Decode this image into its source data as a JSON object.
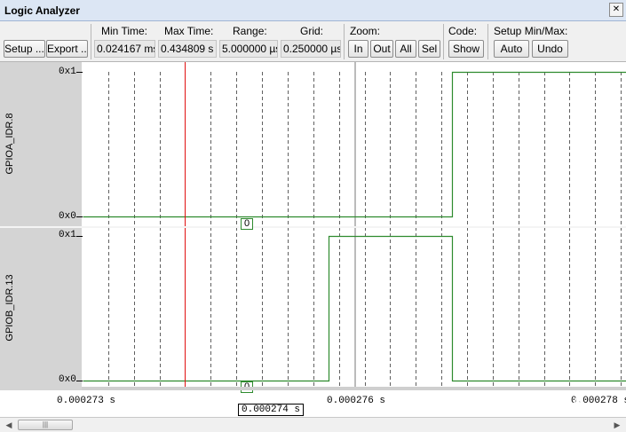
{
  "window": {
    "title": "Logic Analyzer",
    "close_glyph": "✕"
  },
  "toolbar": {
    "setup_label": "Setup ...",
    "export_label": "Export ...",
    "min_time_label": "Min Time:",
    "min_time_value": "0.024167 ms",
    "max_time_label": "Max Time:",
    "max_time_value": "0.434809 s",
    "range_label": "Range:",
    "range_value": "5.000000 µs",
    "grid_label": "Grid:",
    "grid_value": "0.250000 µs",
    "zoom_label": "Zoom:",
    "zoom_in": "In",
    "zoom_out": "Out",
    "zoom_all": "All",
    "zoom_sel": "Sel",
    "code_label": "Code:",
    "code_show": "Show",
    "setup_minmax_label": "Setup Min/Max:",
    "auto_label": "Auto",
    "undo_label": "Undo"
  },
  "signals": [
    {
      "name": "GPIOA_IDR.8",
      "max_label": "0x1",
      "min_label": "0x0",
      "cursor_value": "0"
    },
    {
      "name": "GPIOB_IDR.13",
      "max_label": "0x1",
      "min_label": "0x0",
      "cursor_value": "0"
    }
  ],
  "time_axis": {
    "labels": [
      "0.000273  s",
      "0.000276  s",
      "0.000278  s"
    ],
    "cursor_label": "0.000274  s"
  },
  "scrollbar": {
    "left_arrow": "◀",
    "right_arrow": "▶",
    "thumb_grip": "|||"
  },
  "watermark": {
    "text": "电子发烧友",
    "url": "www.elecfans.com"
  },
  "colors": {
    "trace": "#2e8b2e",
    "cursor": "#e01010",
    "grid": "#606060",
    "name_panel": "#d4d4d4",
    "titlebar": "#dce6f4"
  },
  "chart_data": {
    "type": "line",
    "x_unit": "s",
    "series": [
      {
        "name": "GPIOA_IDR.8",
        "points": [
          [
            0.000273,
            0
          ],
          [
            0.0002766,
            0
          ],
          [
            0.0002766,
            1
          ],
          [
            0.0002783,
            1
          ]
        ]
      },
      {
        "name": "GPIOB_IDR.13",
        "points": [
          [
            0.000273,
            0
          ],
          [
            0.0002754,
            0
          ],
          [
            0.0002754,
            1
          ],
          [
            0.0002766,
            1
          ],
          [
            0.0002766,
            0
          ],
          [
            0.0002783,
            0
          ]
        ]
      }
    ],
    "cursor_x": 0.000274,
    "marker_x": 0.000276,
    "grid_step": 2.5e-07,
    "xlim": [
      0.000273,
      0.0002783
    ],
    "ylim": [
      0,
      1
    ]
  }
}
